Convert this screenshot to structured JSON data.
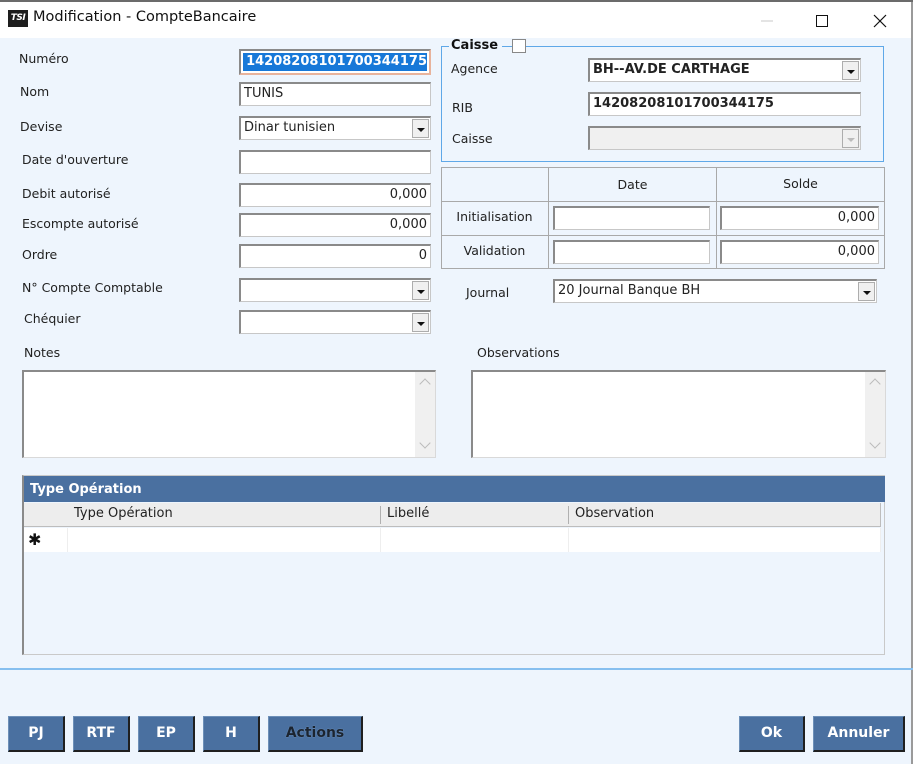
{
  "window": {
    "app_icon_text": "TSI",
    "title": "Modification - CompteBancaire"
  },
  "form": {
    "numero": {
      "label": "Numéro",
      "value": "14208208101700344175"
    },
    "nom": {
      "label": "Nom",
      "value": "TUNIS"
    },
    "devise": {
      "label": "Devise",
      "value": "Dinar tunisien"
    },
    "date_ouverture": {
      "label": "Date d'ouverture",
      "value": ""
    },
    "debit_autorise": {
      "label": "Debit autorisé",
      "value": "0,000"
    },
    "escompte_autorise": {
      "label": "Escompte autorisé",
      "value": "0,000"
    },
    "ordre": {
      "label": "Ordre",
      "value": "0"
    },
    "compte_comptable": {
      "label": "N° Compte Comptable",
      "value": ""
    },
    "chequier": {
      "label": "Chéquier",
      "value": ""
    }
  },
  "caisse_group": {
    "legend": "Caisse",
    "checked": false,
    "agence": {
      "label": "Agence",
      "value": "BH--AV.DE CARTHAGE"
    },
    "rib": {
      "label": "RIB",
      "value": "14208208101700344175"
    },
    "caisse": {
      "label": "Caisse",
      "value": ""
    }
  },
  "soldes": {
    "headers": [
      "",
      "Date",
      "Solde"
    ],
    "rows": [
      {
        "label": "Initialisation",
        "date": "",
        "solde": "0,000"
      },
      {
        "label": "Validation",
        "date": "",
        "solde": "0,000"
      }
    ]
  },
  "journal": {
    "label": "Journal",
    "value": "20  Journal Banque BH"
  },
  "notes": {
    "label": "Notes",
    "value": ""
  },
  "observations": {
    "label": "Observations",
    "value": ""
  },
  "type_operation": {
    "title": "Type Opération",
    "columns": [
      "Type Opération",
      "Libellé",
      "Observation"
    ],
    "new_row_marker": "✱"
  },
  "buttons": {
    "pj": "PJ",
    "rtf": "RTF",
    "ep": "EP",
    "h": "H",
    "actions": "Actions",
    "ok": "Ok",
    "annuler": "Annuler"
  }
}
